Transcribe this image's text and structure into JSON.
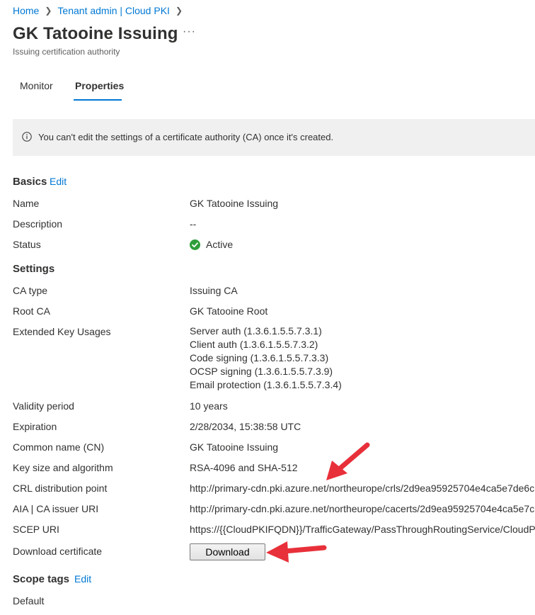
{
  "breadcrumb": {
    "home": "Home",
    "parent": "Tenant admin | Cloud PKI"
  },
  "page": {
    "title": "GK Tatooine Issuing",
    "more": "···",
    "subtitle": "Issuing certification authority"
  },
  "tabs": [
    {
      "label": "Monitor"
    },
    {
      "label": "Properties",
      "active": true
    }
  ],
  "banner": {
    "text": "You can't edit the settings of a certificate authority (CA) once it's created."
  },
  "basics": {
    "heading": "Basics",
    "edit": "Edit",
    "name_label": "Name",
    "name_value": "GK Tatooine Issuing",
    "description_label": "Description",
    "description_value": "--",
    "status_label": "Status",
    "status_value": "Active"
  },
  "settings": {
    "heading": "Settings",
    "ca_type_label": "CA type",
    "ca_type_value": "Issuing CA",
    "root_ca_label": "Root CA",
    "root_ca_value": "GK Tatooine Root",
    "eku_label": "Extended Key Usages",
    "eku_values": [
      "Server auth (1.3.6.1.5.5.7.3.1)",
      "Client auth (1.3.6.1.5.5.7.3.2)",
      "Code signing (1.3.6.1.5.5.7.3.3)",
      "OCSP signing (1.3.6.1.5.5.7.3.9)",
      "Email protection (1.3.6.1.5.5.7.3.4)"
    ],
    "validity_label": "Validity period",
    "validity_value": "10 years",
    "expiration_label": "Expiration",
    "expiration_value": "2/28/2034, 15:38:58 UTC",
    "cn_label": "Common name (CN)",
    "cn_value": "GK Tatooine Issuing",
    "key_label": "Key size and algorithm",
    "key_value": "RSA-4096 and SHA-512",
    "crl_label": "CRL distribution point",
    "crl_value": "http://primary-cdn.pki.azure.net/northeurope/crls/2d9ea95925704e4ca5e7de6c",
    "aia_label": "AIA | CA issuer URI",
    "aia_value": "http://primary-cdn.pki.azure.net/northeurope/cacerts/2d9ea95925704e4ca5e7c",
    "scep_label": "SCEP URI",
    "scep_value": "https://{{CloudPKIFQDN}}/TrafficGateway/PassThroughRoutingService/CloudPki",
    "download_label": "Download certificate",
    "download_button": "Download"
  },
  "scope_tags": {
    "heading": "Scope tags",
    "edit": "Edit",
    "value": "Default"
  },
  "colors": {
    "accent": "#0078d4",
    "success": "#2e9e3a",
    "annotation_arrow": "#e8303a",
    "banner_bg": "#f0f0f0"
  }
}
